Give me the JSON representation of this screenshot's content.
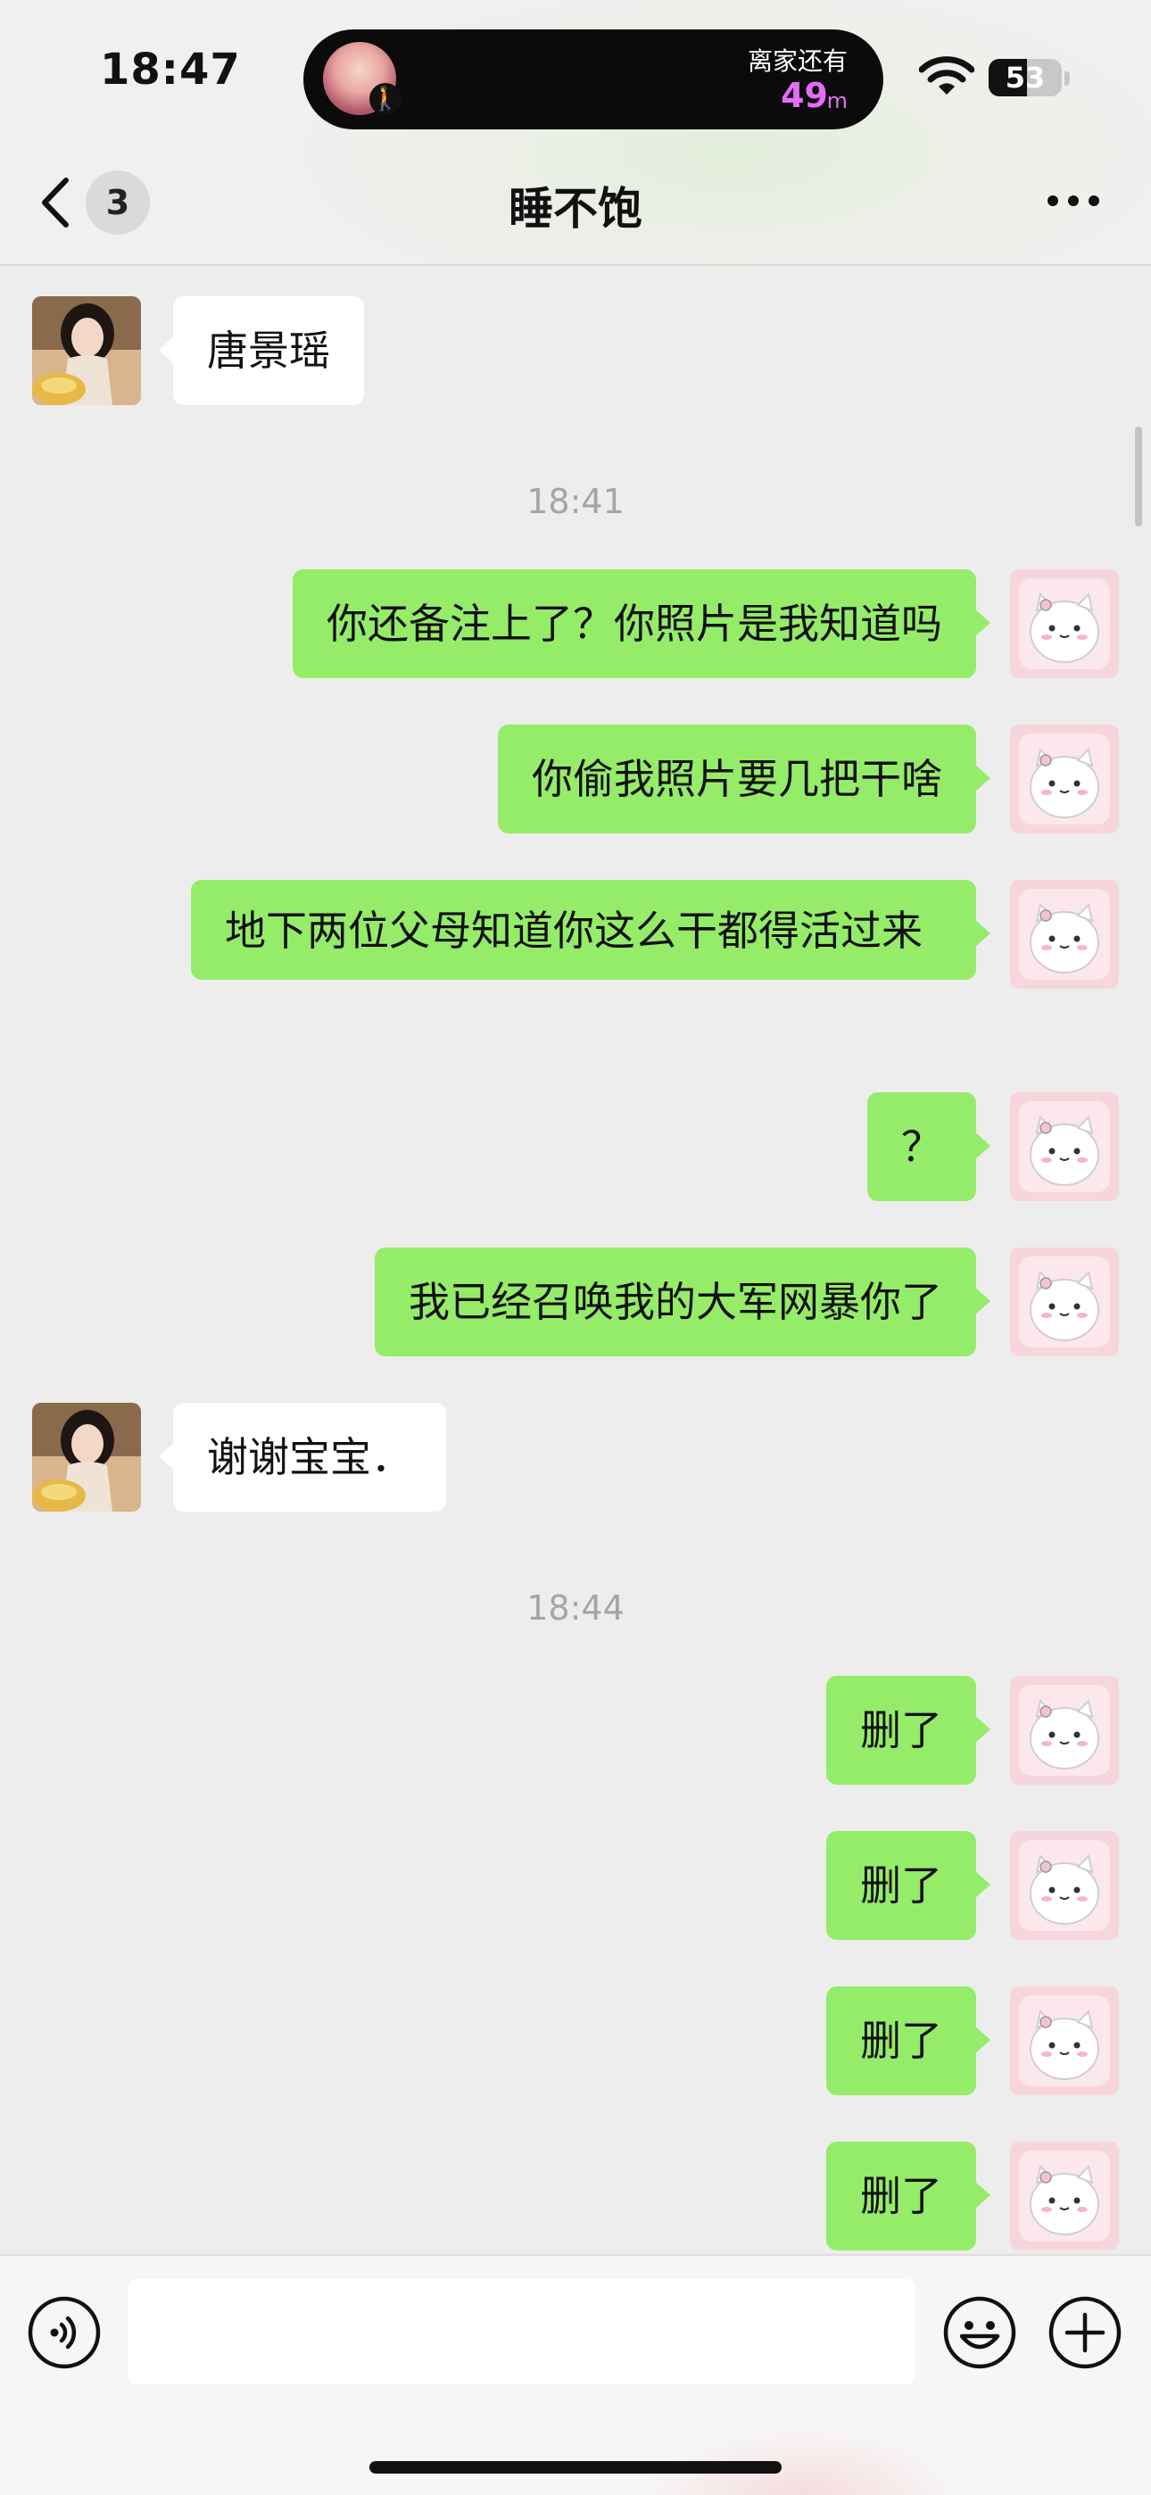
{
  "status_bar": {
    "time": "18:47",
    "activity_label": "离家还有",
    "activity_distance": "49",
    "activity_unit": "m",
    "battery_level": "53",
    "battery_fraction": 0.53
  },
  "nav": {
    "unread_count": "3",
    "title": "睡不饱"
  },
  "messages": [
    {
      "side": "in",
      "text": "唐景瑶"
    },
    {
      "type": "time",
      "text": "18:41"
    },
    {
      "side": "out",
      "text": "你还备注上了？你照片是我知道吗"
    },
    {
      "side": "out",
      "text": "你偷我照片要几把干啥"
    },
    {
      "side": "out",
      "text": "地下两位父母知道你这么干都得活过来"
    },
    {
      "side": "out",
      "text": "？"
    },
    {
      "side": "out",
      "text": "我已经召唤我的大军网暴你了"
    },
    {
      "side": "in",
      "text": "谢谢宝宝．"
    },
    {
      "type": "time",
      "text": "18:44"
    },
    {
      "side": "out",
      "text": "删了"
    },
    {
      "side": "out",
      "text": "删了"
    },
    {
      "side": "out",
      "text": "删了"
    },
    {
      "side": "out",
      "text": "删了"
    }
  ],
  "input": {
    "value": ""
  },
  "colors": {
    "outgoing_bubble": "#95ec69",
    "incoming_bubble": "#ffffff",
    "chat_background": "#ededed",
    "activity_accent": "#e36ef5"
  },
  "icons": {
    "back": "chevron-left-icon",
    "more": "more-dots-icon",
    "voice": "voice-icon",
    "emoji": "emoji-icon",
    "plus": "plus-icon",
    "wifi": "wifi-icon"
  }
}
